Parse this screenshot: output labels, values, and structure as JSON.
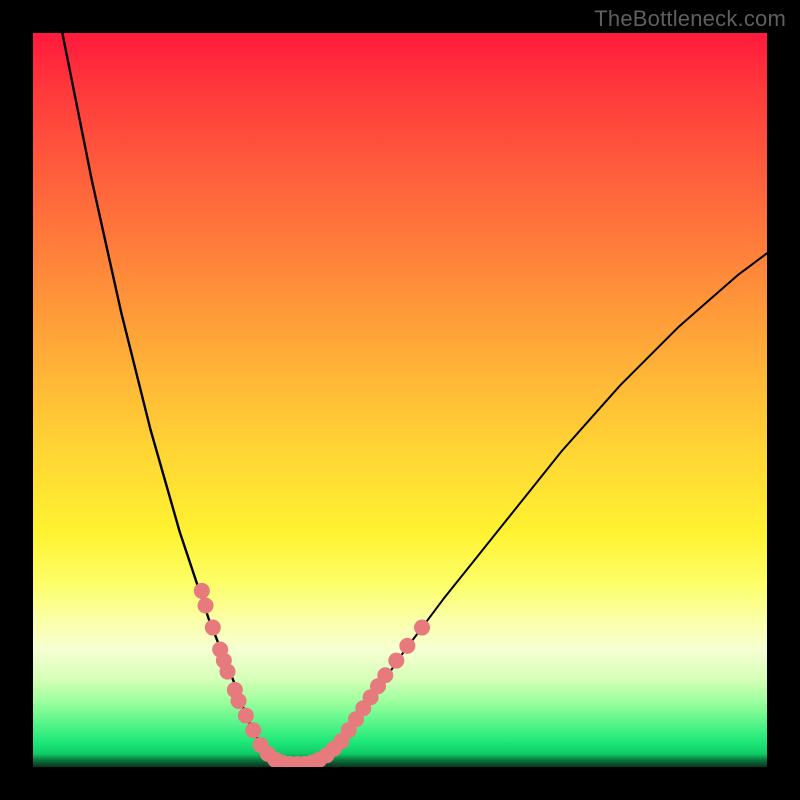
{
  "watermark": "TheBottleneck.com",
  "chart_data": {
    "type": "line",
    "title": "",
    "xlabel": "",
    "ylabel": "",
    "xlim": [
      0,
      100
    ],
    "ylim": [
      0,
      100
    ],
    "grid": false,
    "legend": false,
    "series": [
      {
        "name": "left-curve",
        "x": [
          4,
          6,
          8,
          10,
          12,
          14,
          16,
          18,
          20,
          22,
          24,
          26,
          28,
          29,
          30,
          31,
          32,
          33
        ],
        "values": [
          100,
          90,
          80,
          71,
          62,
          54,
          46,
          39,
          32,
          26,
          20,
          15,
          10,
          7,
          5,
          3,
          1.5,
          0.5
        ]
      },
      {
        "name": "valley-floor",
        "x": [
          33,
          34,
          35,
          36,
          37,
          38,
          39,
          40
        ],
        "values": [
          0.5,
          0.2,
          0.1,
          0.1,
          0.1,
          0.2,
          0.4,
          0.8
        ]
      },
      {
        "name": "right-curve",
        "x": [
          40,
          42,
          44,
          46,
          48,
          50,
          53,
          56,
          60,
          64,
          68,
          72,
          76,
          80,
          84,
          88,
          92,
          96,
          100
        ],
        "values": [
          0.8,
          3,
          6,
          9,
          12,
          15,
          19,
          23,
          28,
          33,
          38,
          43,
          47.5,
          52,
          56,
          60,
          63.5,
          67,
          70
        ]
      }
    ],
    "highlight_dots": {
      "left": [
        {
          "x": 23,
          "y": 24
        },
        {
          "x": 23.5,
          "y": 22
        },
        {
          "x": 24.5,
          "y": 19
        },
        {
          "x": 25.5,
          "y": 16
        },
        {
          "x": 26,
          "y": 14.5
        },
        {
          "x": 26.5,
          "y": 13
        },
        {
          "x": 27.5,
          "y": 10.5
        },
        {
          "x": 28,
          "y": 9
        },
        {
          "x": 29,
          "y": 7
        },
        {
          "x": 30,
          "y": 5
        }
      ],
      "floor": [
        {
          "x": 31,
          "y": 3
        },
        {
          "x": 32,
          "y": 1.8
        },
        {
          "x": 33,
          "y": 1
        },
        {
          "x": 34,
          "y": 0.6
        },
        {
          "x": 35,
          "y": 0.4
        },
        {
          "x": 36,
          "y": 0.4
        },
        {
          "x": 37,
          "y": 0.4
        },
        {
          "x": 38,
          "y": 0.6
        },
        {
          "x": 39,
          "y": 1
        },
        {
          "x": 40,
          "y": 1.6
        }
      ],
      "right": [
        {
          "x": 41,
          "y": 2.5
        },
        {
          "x": 42,
          "y": 3.5
        },
        {
          "x": 43,
          "y": 5
        },
        {
          "x": 44,
          "y": 6.5
        },
        {
          "x": 45,
          "y": 8
        },
        {
          "x": 46,
          "y": 9.5
        },
        {
          "x": 47,
          "y": 11
        },
        {
          "x": 48,
          "y": 12.5
        },
        {
          "x": 49.5,
          "y": 14.5
        },
        {
          "x": 51,
          "y": 16.5
        },
        {
          "x": 53,
          "y": 19
        }
      ]
    },
    "highlight_color": "#e77a7d",
    "curve_color": "#000000"
  }
}
